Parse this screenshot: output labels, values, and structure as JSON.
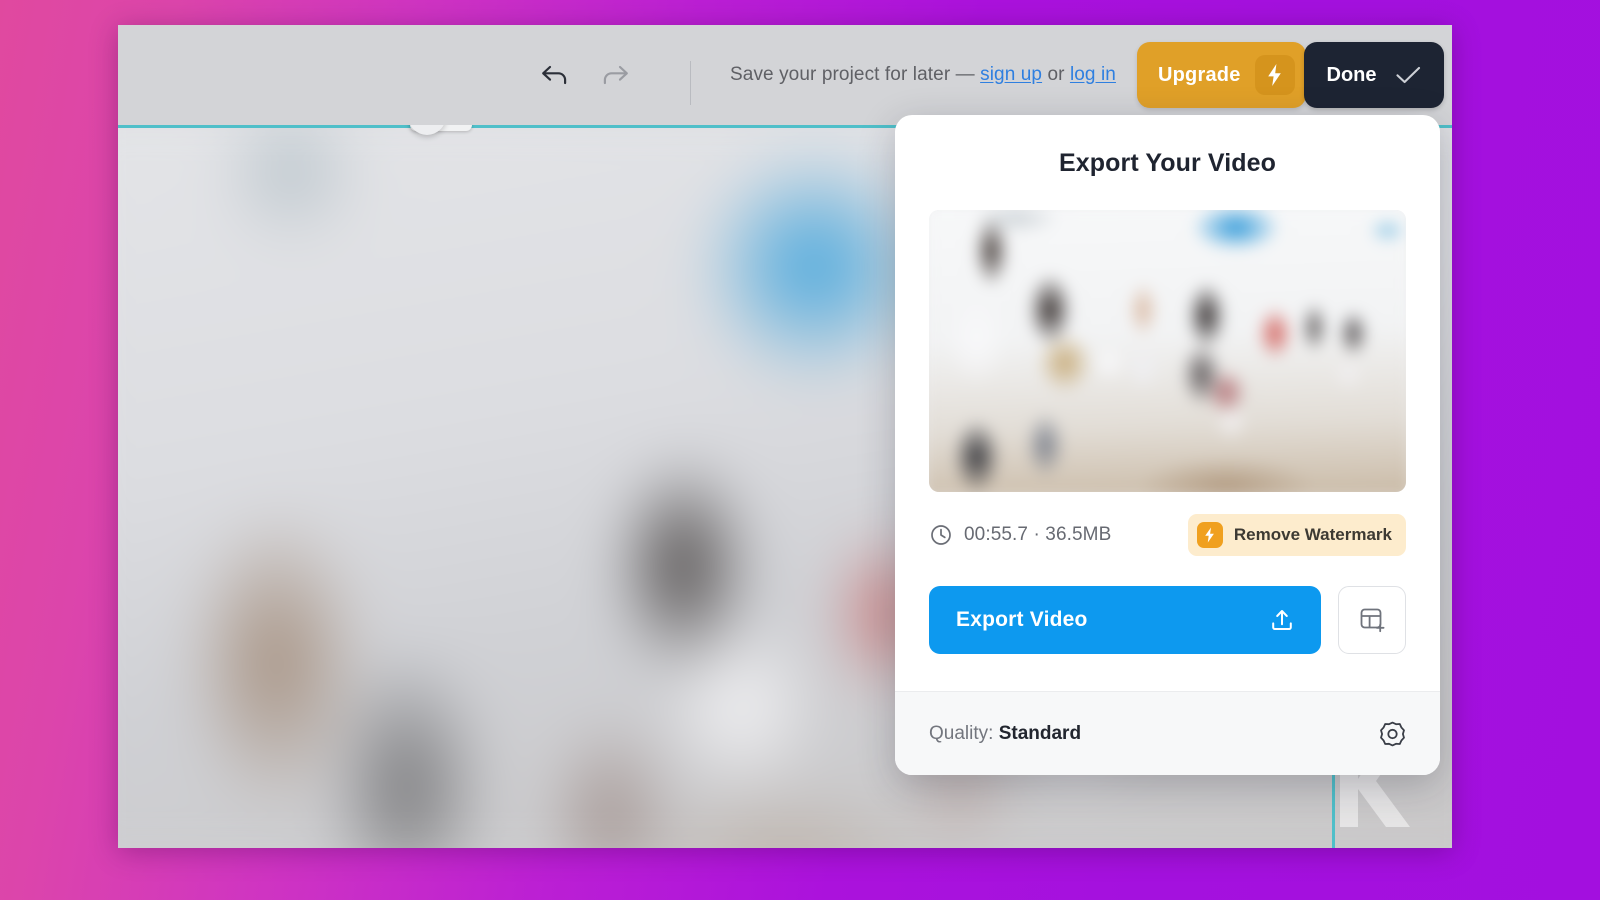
{
  "backdrop": {
    "gradient_from": "#e0499f",
    "gradient_to": "#a30fdf"
  },
  "toolbar": {
    "undo_icon": "undo-arrow-icon",
    "redo_icon": "redo-arrow-icon",
    "save_note_prefix": "Save your project for later — ",
    "sign_up_label": "sign up",
    "save_note_conjunction": " or ",
    "log_in_label": "log in",
    "upgrade_label": "Upgrade",
    "upgrade_icon": "lightning-bolt-icon",
    "upgrade_color": "#e0a028",
    "done_label": "Done",
    "done_icon": "checkmark-icon",
    "done_color": "#1d2433"
  },
  "canvas": {
    "rotate_handle_icon": "rotate-icon",
    "top_drag_handle_icon": "drag-handle-icon",
    "selection_color": "#4fbfc9",
    "watermark_icon": "brand-logo-watermark"
  },
  "export_panel": {
    "title": "Export Your Video",
    "thumbnail_name": "video-thumbnail-preview",
    "clock_icon": "clock-icon",
    "duration": "00:55.7",
    "separator": " · ",
    "file_size": "36.5MB",
    "meta_text": "00:55.7 · 36.5MB",
    "remove_watermark_label": "Remove Watermark",
    "remove_watermark_icon": "lightning-bolt-icon",
    "remove_watermark_bg": "#fdeccd",
    "export_label": "Export Video",
    "export_icon": "upload-icon",
    "export_color": "#0d99ef",
    "template_button_icon": "add-to-template-icon",
    "quality_label": "Quality: ",
    "quality_value": "Standard",
    "quality_gear_icon": "gear-icon"
  }
}
